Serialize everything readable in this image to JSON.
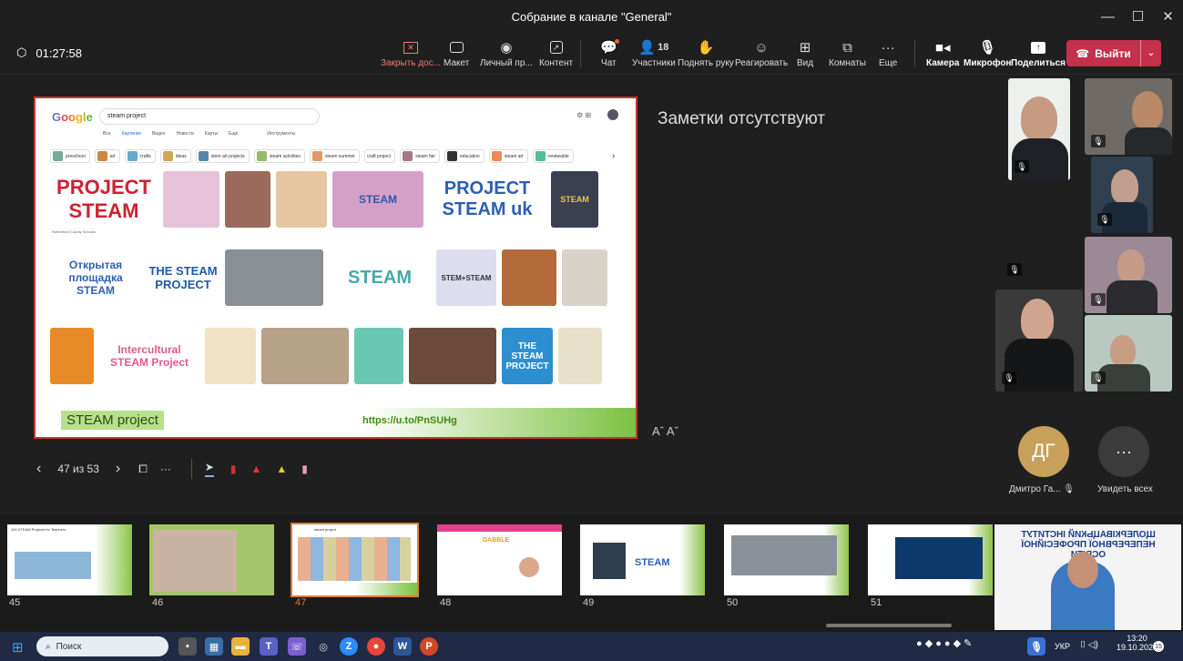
{
  "window": {
    "title": "Собрание в канале \"General\"",
    "minimize": "—",
    "maximize": "☐",
    "close": "✕"
  },
  "toolbar": {
    "timer": "01:27:58",
    "stop_share": "Закрыть дос...",
    "layout": "Макет",
    "personal": "Личный пр...",
    "content": "Контент",
    "chat": "Чат",
    "participants": "Участники",
    "participants_count": "18",
    "raise_hand": "Поднять руку",
    "react": "Реагировать",
    "view": "Вид",
    "rooms": "Комнаты",
    "more": "Еще",
    "camera": "Камера",
    "mic": "Микрофон",
    "share": "Поделиться",
    "leave": "Выйти"
  },
  "slide": {
    "google_logo": "Google",
    "search_query": "steam project",
    "tabs": [
      "Все",
      "Картинки",
      "Видео",
      "Новости",
      "Карты",
      "Ещё",
      "Инструменты"
    ],
    "chips": [
      "preschool",
      "art",
      "crafts",
      "ideas",
      "stem art projects",
      "steam activities",
      "steam summer",
      "craft project",
      "steam fair",
      "education",
      "steam art",
      "renewable"
    ],
    "image_texts": [
      "PROJECT STEAM",
      "",
      "",
      "",
      "STEAM",
      "PROJECT STEAM uk",
      "STEAM",
      "Открытая площадка STEAM",
      "THE STEAM PROJECT",
      "",
      "STEAM",
      "STEM+STEAM",
      "",
      "",
      "",
      "Intercultural STEAM Project",
      "",
      "",
      "",
      "",
      "THE STEAM PROJECT",
      ""
    ],
    "label": "STEAM project",
    "link": "https://u.to/PnSUHg"
  },
  "notes": {
    "text": "Заметки отсутствуют",
    "font_buttons": "Aˆ  Aˇ"
  },
  "slide_nav": {
    "counter": "47 из 53"
  },
  "participant": {
    "initials": "ДГ",
    "name": "Дмитро Га...",
    "see_all": "Увидеть всех"
  },
  "thumbnails": [
    {
      "num": "45",
      "text": "100 STEAM Projects for Teachers"
    },
    {
      "num": "46",
      "text": ""
    },
    {
      "num": "47",
      "text": "steam project"
    },
    {
      "num": "48",
      "text": "DABBLE"
    },
    {
      "num": "49",
      "text": "STEAM"
    },
    {
      "num": "50",
      "text": ""
    },
    {
      "num": "51",
      "text": ""
    },
    {
      "num": "",
      "text": "ЩОЛЕРКІВАЦЬКИЙ ІНСТИТУТ НЕПЕРЕРВНОЇ ПРОФЕСІЙНОЇ ОСВІТИ"
    }
  ],
  "taskbar": {
    "search": "Поиск",
    "lang": "УКР",
    "time": "13:20",
    "date": "19.10.2023",
    "badge": "15"
  }
}
